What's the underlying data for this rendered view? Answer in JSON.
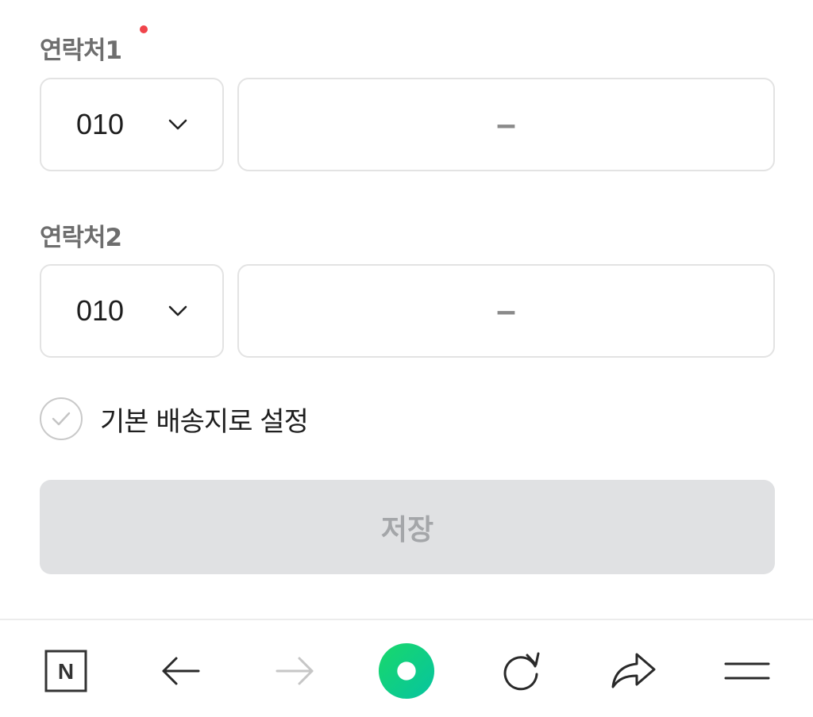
{
  "contact1": {
    "label": "연락처1",
    "prefix": "010",
    "number_separator": "–"
  },
  "contact2": {
    "label": "연락처2",
    "prefix": "010",
    "number_separator": "–"
  },
  "default_address": {
    "label": "기본 배송지로 설정",
    "checked": false
  },
  "save_button": {
    "label": "저장",
    "enabled": false
  },
  "colors": {
    "required_dot": "#f0444b",
    "brand_green": "#03c75a"
  },
  "browser_toolbar": {
    "icons": [
      "naver-home-icon",
      "back-arrow-icon",
      "forward-arrow-icon",
      "green-dot-icon",
      "refresh-icon",
      "share-icon",
      "menu-icon"
    ],
    "home_letter": "N"
  }
}
